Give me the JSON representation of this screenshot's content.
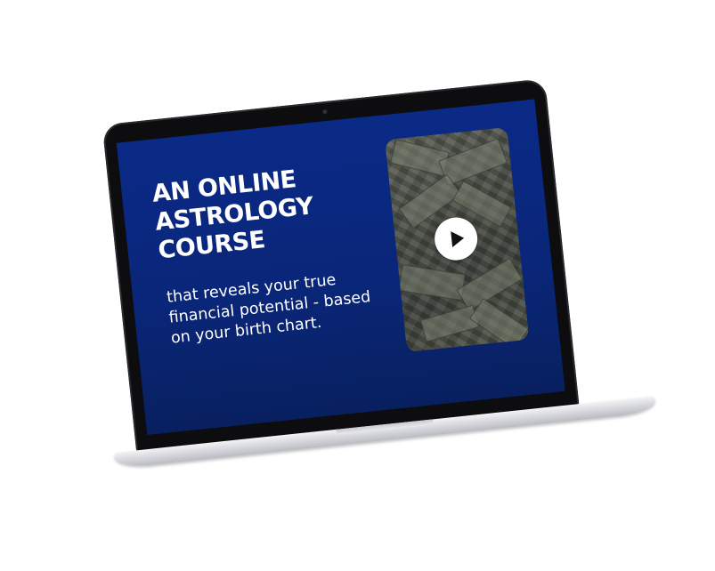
{
  "headline": [
    "AN ONLINE",
    "ASTROLOGY",
    "COURSE"
  ],
  "subhead": "that reveals your true financial potential - based on your birth chart.",
  "video": {
    "play_icon": "play-icon"
  },
  "colors": {
    "screen_background": "#0a2a87",
    "text": "#ffffff",
    "play_button": "#ffffff"
  }
}
